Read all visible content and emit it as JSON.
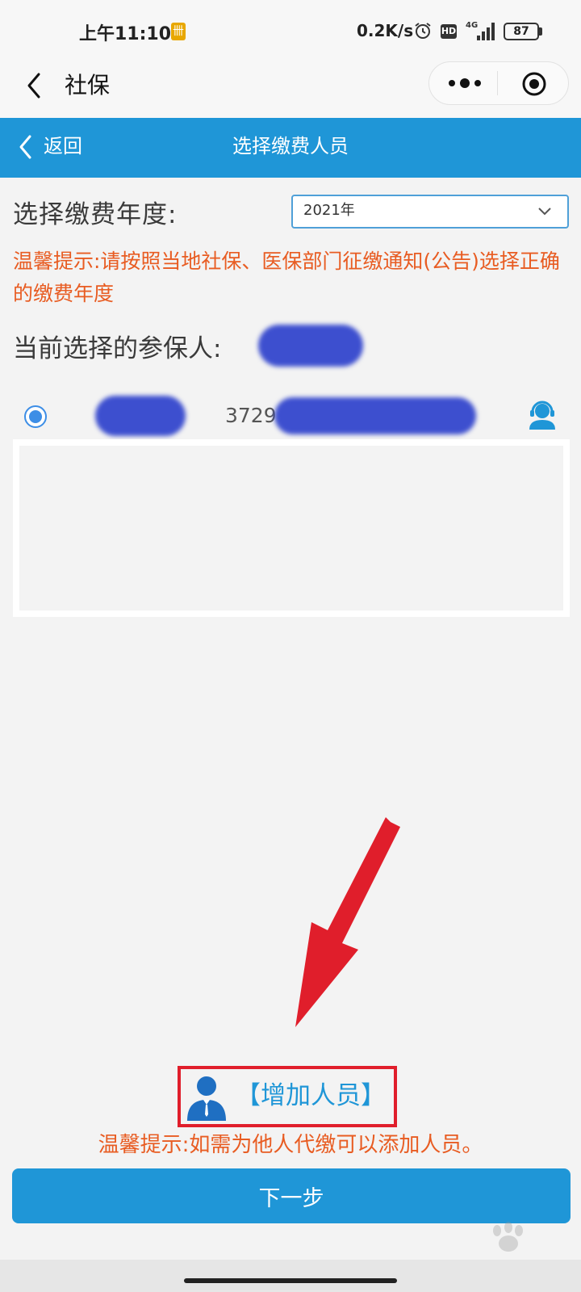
{
  "status_bar": {
    "time": "上午11:10",
    "sim_badge": "卌",
    "net_speed": "0.2K/s",
    "hd": "HD",
    "net_type": "4G",
    "battery": "87"
  },
  "title_bar": {
    "title": "社保",
    "icons": [
      "back-arrow-icon",
      "more-dots-icon",
      "target-close-icon"
    ]
  },
  "header": {
    "back_label": "返回",
    "title": "选择缴费人员"
  },
  "year": {
    "label": "选择缴费年度:",
    "selected": "2021年"
  },
  "tip_year": "温馨提示:请按照当地社保、医保部门征缴通知(公告)选择正确的缴费年度",
  "current": {
    "label": "当前选择的参保人:"
  },
  "person": {
    "id_prefix": "3729"
  },
  "add_person": {
    "label": "【增加人员】"
  },
  "tip_add": "温馨提示:如需为他人代缴可以添加人员。",
  "next_label": "下一步",
  "colors": {
    "brand_blue": "#1f96d7",
    "warning_orange": "#e85c22",
    "annotation_red": "#e01e2b",
    "redaction_blue": "#3d4fcf"
  }
}
